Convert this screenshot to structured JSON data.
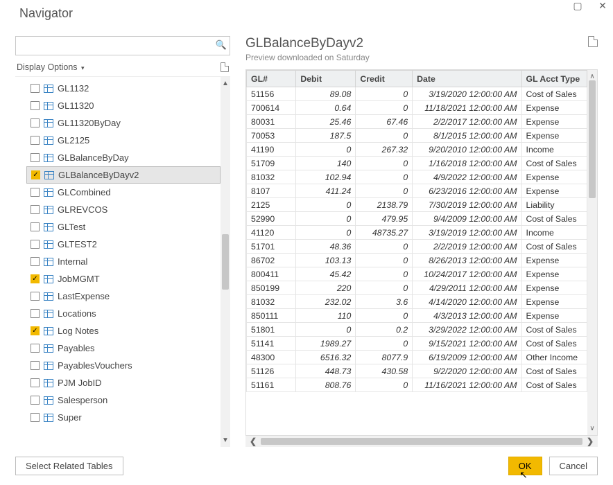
{
  "window": {
    "title": "Navigator"
  },
  "left": {
    "display_options": "Display Options",
    "search_placeholder": "",
    "items": [
      {
        "label": "GL1132",
        "checked": false,
        "selected": false
      },
      {
        "label": "GL11320",
        "checked": false,
        "selected": false
      },
      {
        "label": "GL11320ByDay",
        "checked": false,
        "selected": false
      },
      {
        "label": "GL2125",
        "checked": false,
        "selected": false
      },
      {
        "label": "GLBalanceByDay",
        "checked": false,
        "selected": false
      },
      {
        "label": "GLBalanceByDayv2",
        "checked": true,
        "selected": true
      },
      {
        "label": "GLCombined",
        "checked": false,
        "selected": false
      },
      {
        "label": "GLREVCOS",
        "checked": false,
        "selected": false
      },
      {
        "label": "GLTest",
        "checked": false,
        "selected": false
      },
      {
        "label": "GLTEST2",
        "checked": false,
        "selected": false
      },
      {
        "label": "Internal",
        "checked": false,
        "selected": false
      },
      {
        "label": "JobMGMT",
        "checked": true,
        "selected": false
      },
      {
        "label": "LastExpense",
        "checked": false,
        "selected": false
      },
      {
        "label": "Locations",
        "checked": false,
        "selected": false
      },
      {
        "label": "Log Notes",
        "checked": true,
        "selected": false
      },
      {
        "label": "Payables",
        "checked": false,
        "selected": false
      },
      {
        "label": "PayablesVouchers",
        "checked": false,
        "selected": false
      },
      {
        "label": "PJM JobID",
        "checked": false,
        "selected": false
      },
      {
        "label": "Salesperson",
        "checked": false,
        "selected": false
      },
      {
        "label": "Super",
        "checked": false,
        "selected": false
      }
    ]
  },
  "preview": {
    "title": "GLBalanceByDayv2",
    "subtitle": "Preview downloaded on Saturday",
    "columns": [
      "GL#",
      "Debit",
      "Credit",
      "Date",
      "GL Acct Type"
    ],
    "rows": [
      {
        "gl": "51156",
        "debit": "89.08",
        "credit": "0",
        "date": "3/19/2020 12:00:00 AM",
        "type": "Cost of Sales"
      },
      {
        "gl": "700614",
        "debit": "0.64",
        "credit": "0",
        "date": "11/18/2021 12:00:00 AM",
        "type": "Expense"
      },
      {
        "gl": "80031",
        "debit": "25.46",
        "credit": "67.46",
        "date": "2/2/2017 12:00:00 AM",
        "type": "Expense"
      },
      {
        "gl": "70053",
        "debit": "187.5",
        "credit": "0",
        "date": "8/1/2015 12:00:00 AM",
        "type": "Expense"
      },
      {
        "gl": "41190",
        "debit": "0",
        "credit": "267.32",
        "date": "9/20/2010 12:00:00 AM",
        "type": "Income"
      },
      {
        "gl": "51709",
        "debit": "140",
        "credit": "0",
        "date": "1/16/2018 12:00:00 AM",
        "type": "Cost of Sales"
      },
      {
        "gl": "81032",
        "debit": "102.94",
        "credit": "0",
        "date": "4/9/2022 12:00:00 AM",
        "type": "Expense"
      },
      {
        "gl": "8107",
        "debit": "411.24",
        "credit": "0",
        "date": "6/23/2016 12:00:00 AM",
        "type": "Expense"
      },
      {
        "gl": "2125",
        "debit": "0",
        "credit": "2138.79",
        "date": "7/30/2019 12:00:00 AM",
        "type": "Liability"
      },
      {
        "gl": "52990",
        "debit": "0",
        "credit": "479.95",
        "date": "9/4/2009 12:00:00 AM",
        "type": "Cost of Sales"
      },
      {
        "gl": "41120",
        "debit": "0",
        "credit": "48735.27",
        "date": "3/19/2019 12:00:00 AM",
        "type": "Income"
      },
      {
        "gl": "51701",
        "debit": "48.36",
        "credit": "0",
        "date": "2/2/2019 12:00:00 AM",
        "type": "Cost of Sales"
      },
      {
        "gl": "86702",
        "debit": "103.13",
        "credit": "0",
        "date": "8/26/2013 12:00:00 AM",
        "type": "Expense"
      },
      {
        "gl": "800411",
        "debit": "45.42",
        "credit": "0",
        "date": "10/24/2017 12:00:00 AM",
        "type": "Expense"
      },
      {
        "gl": "850199",
        "debit": "220",
        "credit": "0",
        "date": "4/29/2011 12:00:00 AM",
        "type": "Expense"
      },
      {
        "gl": "81032",
        "debit": "232.02",
        "credit": "3.6",
        "date": "4/14/2020 12:00:00 AM",
        "type": "Expense"
      },
      {
        "gl": "850111",
        "debit": "110",
        "credit": "0",
        "date": "4/3/2013 12:00:00 AM",
        "type": "Expense"
      },
      {
        "gl": "51801",
        "debit": "0",
        "credit": "0.2",
        "date": "3/29/2022 12:00:00 AM",
        "type": "Cost of Sales"
      },
      {
        "gl": "51141",
        "debit": "1989.27",
        "credit": "0",
        "date": "9/15/2021 12:00:00 AM",
        "type": "Cost of Sales"
      },
      {
        "gl": "48300",
        "debit": "6516.32",
        "credit": "8077.9",
        "date": "6/19/2009 12:00:00 AM",
        "type": "Other Income"
      },
      {
        "gl": "51126",
        "debit": "448.73",
        "credit": "430.58",
        "date": "9/2/2020 12:00:00 AM",
        "type": "Cost of Sales"
      },
      {
        "gl": "51161",
        "debit": "808.76",
        "credit": "0",
        "date": "11/16/2021 12:00:00 AM",
        "type": "Cost of Sales"
      }
    ]
  },
  "footer": {
    "select_related": "Select Related Tables",
    "ok": "OK",
    "cancel": "Cancel"
  }
}
